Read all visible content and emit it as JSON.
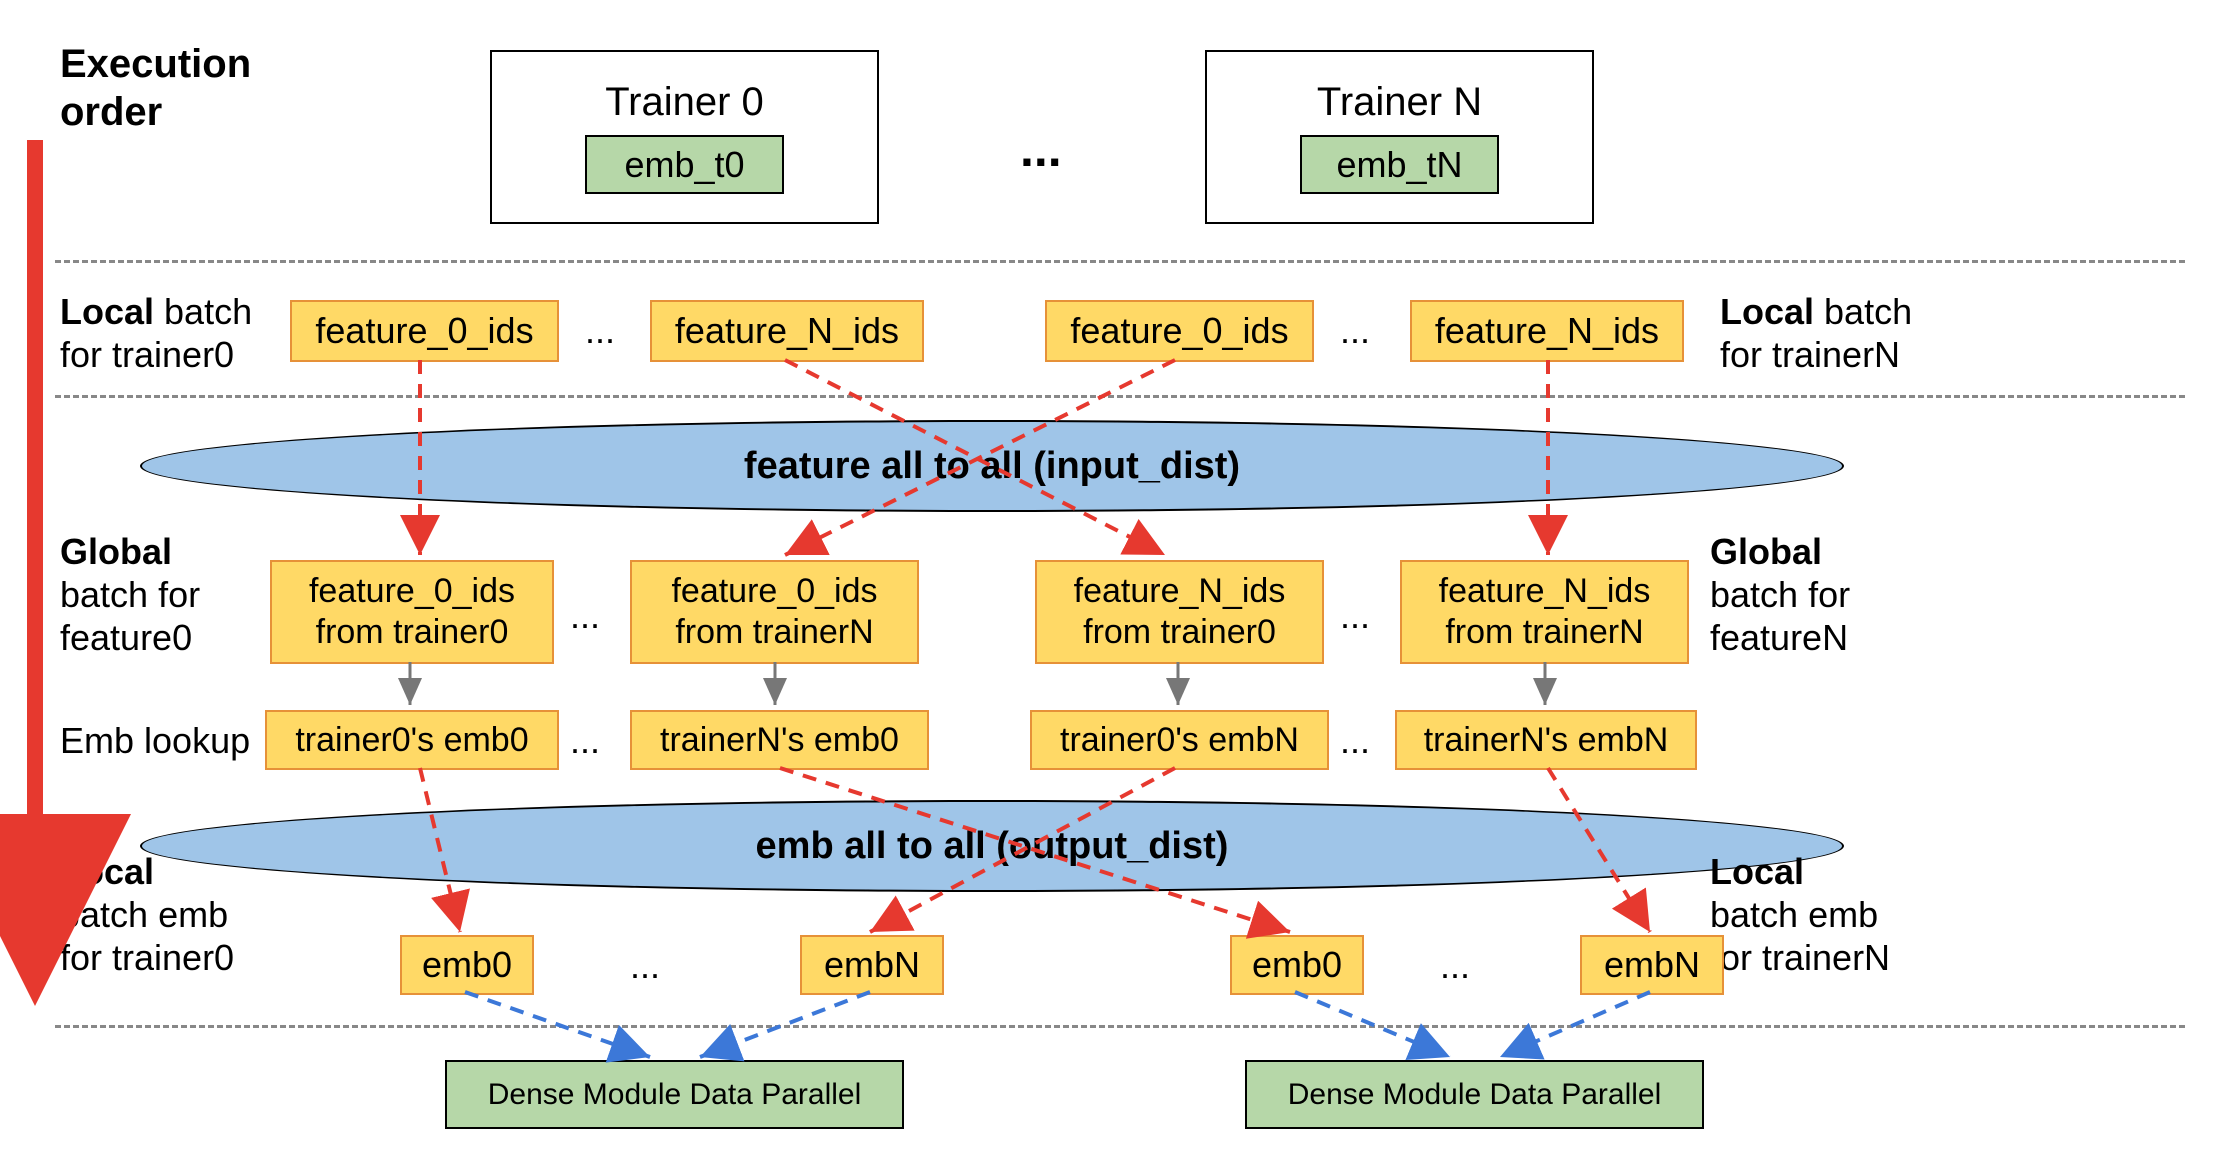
{
  "chart_data": {
    "type": "flow-diagram",
    "title": "Execution order",
    "trainers": [
      {
        "name": "Trainer 0",
        "embedding": "emb_t0"
      },
      {
        "name": "Trainer N",
        "embedding": "emb_tN"
      }
    ],
    "row_local_batch": {
      "left_label": "Local batch for trainer0",
      "right_label": "Local batch for trainerN",
      "left_group": [
        "feature_0_ids",
        "feature_N_ids"
      ],
      "right_group": [
        "feature_0_ids",
        "feature_N_ids"
      ]
    },
    "feature_alltoall": "feature all to all (input_dist)",
    "row_global_batch": {
      "left_label": "Global batch for feature0",
      "right_label": "Global batch for featureN",
      "items": [
        [
          "feature_0_ids",
          "from trainer0"
        ],
        [
          "feature_0_ids",
          "from trainerN"
        ],
        [
          "feature_N_ids",
          "from trainer0"
        ],
        [
          "feature_N_ids",
          "from trainerN"
        ]
      ]
    },
    "row_emb_lookup": {
      "label": "Emb lookup",
      "items": [
        "trainer0's emb0",
        "trainerN's emb0",
        "trainer0's embN",
        "trainerN's embN"
      ]
    },
    "emb_alltoall": "emb all to all (output_dist)",
    "row_local_emb": {
      "left_label": "Local batch emb for trainer0",
      "right_label": "Local batch emb for trainerN",
      "left_group": [
        "emb0",
        "embN"
      ],
      "right_group": [
        "emb0",
        "embN"
      ]
    },
    "dense": "Dense Module Data Parallel"
  },
  "labels": {
    "exec_l1": "Execution",
    "exec_l2": "order",
    "trainer0": "Trainer 0",
    "trainerN": "Trainer N",
    "emb_t0": "emb_t0",
    "emb_tN": "emb_tN",
    "dots": "...",
    "local": "Local",
    "batch_for_t0": "batch",
    "for_trainer0": "for trainer0",
    "for_trainerN": "for trainerN",
    "feature_0_ids": "feature_0_ids",
    "feature_N_ids": "feature_N_ids",
    "feat_a2a": "feature all to all (input_dist)",
    "global": "Global",
    "batch_for": "batch for",
    "feature0": "feature0",
    "featureN": "featureN",
    "f0_from_t0_l1": "feature_0_ids",
    "f0_from_t0_l2": "from trainer0",
    "f0_from_tN_l1": "feature_0_ids",
    "f0_from_tN_l2": "from trainerN",
    "fN_from_t0_l1": "feature_N_ids",
    "fN_from_t0_l2": "from trainer0",
    "fN_from_tN_l1": "feature_N_ids",
    "fN_from_tN_l2": "from trainerN",
    "emb_lookup": "Emb lookup",
    "t0_emb0": "trainer0's emb0",
    "tN_emb0": "trainerN's emb0",
    "t0_embN": "trainer0's embN",
    "tN_embN": "trainerN's embN",
    "emb_a2a": "emb all to all (output_dist)",
    "batch_emb": "batch emb",
    "emb0": "emb0",
    "embN": "embN",
    "dense": "Dense Module Data Parallel"
  }
}
